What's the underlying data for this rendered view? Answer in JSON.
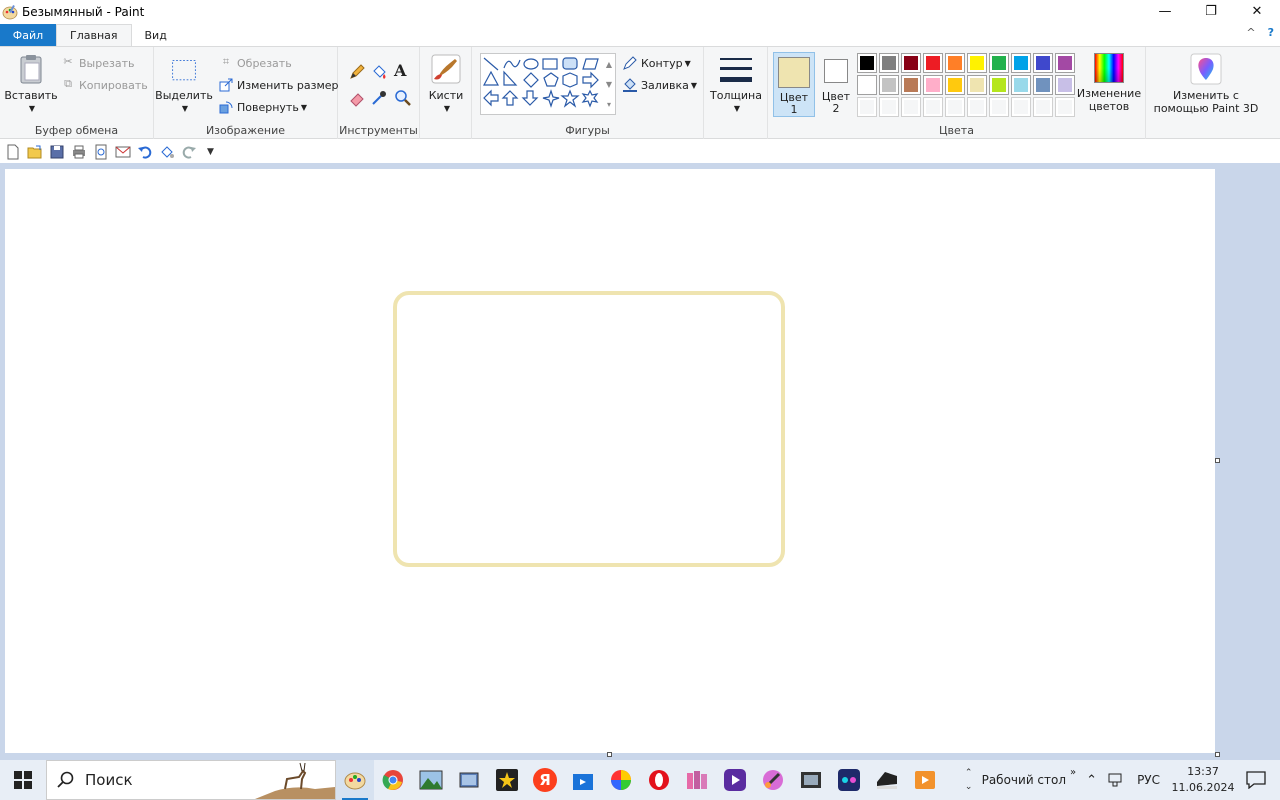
{
  "window": {
    "title": "Безымянный - Paint",
    "controls": {
      "minimize": "—",
      "maximize": "❐",
      "close": "✕"
    }
  },
  "tabs": {
    "file": "Файл",
    "home": "Главная",
    "view": "Вид"
  },
  "help": {
    "collapse": "^",
    "help": "?"
  },
  "ribbon": {
    "clipboard": {
      "label": "Буфер обмена",
      "paste": "Вставить",
      "cut": "Вырезать",
      "copy": "Копировать"
    },
    "image": {
      "label": "Изображение",
      "select": "Выделить",
      "crop": "Обрезать",
      "resize": "Изменить размер",
      "rotate": "Повернуть"
    },
    "tools": {
      "label": "Инструменты"
    },
    "brushes": {
      "label": "Кисти"
    },
    "shapes": {
      "label": "Фигуры",
      "outline": "Контур",
      "fill": "Заливка"
    },
    "size": {
      "label": "Толщина"
    },
    "colors": {
      "label": "Цвета",
      "color1": "Цвет 1",
      "color1_line1": "Цвет",
      "color1_line2": "1",
      "color2_line1": "Цвет",
      "color2_line2": "2",
      "color1_value": "#efe4b0",
      "color2_value": "#ffffff",
      "edit_line1": "Изменение",
      "edit_line2": "цветов",
      "palette_row1": [
        "#000000",
        "#7f7f7f",
        "#880015",
        "#ed1c24",
        "#ff7f27",
        "#fff200",
        "#22b14c",
        "#00a2e8",
        "#3f48cc",
        "#a349a4"
      ],
      "palette_row2": [
        "#ffffff",
        "#c3c3c3",
        "#b97a57",
        "#ffaec9",
        "#ffc90e",
        "#efe4b0",
        "#b5e61d",
        "#99d9ea",
        "#7092be",
        "#c8bfe7"
      ]
    },
    "paint3d": {
      "line1": "Изменить с",
      "line2": "помощью Paint 3D"
    }
  },
  "taskbar": {
    "search": "Поиск",
    "desktop": "Рабочий стол",
    "chevron": "»",
    "lang": "РУС",
    "time": "13:37",
    "date": "11.06.2024"
  }
}
